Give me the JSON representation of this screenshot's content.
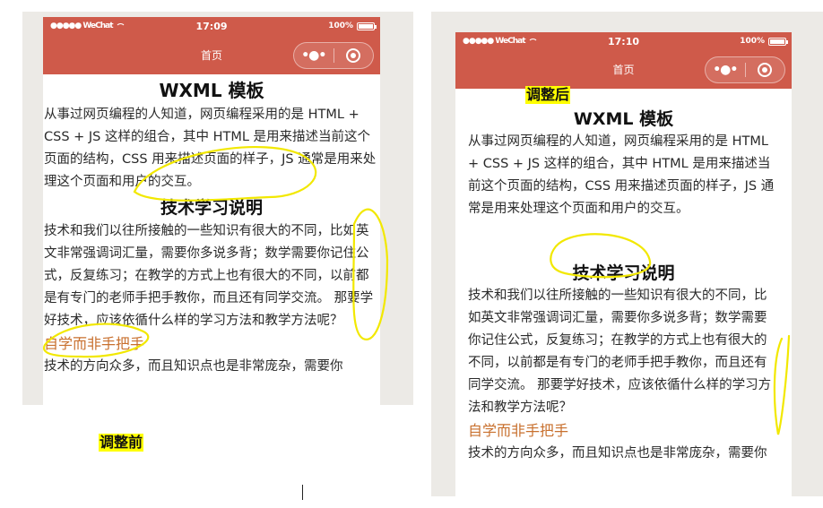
{
  "labels": {
    "before": "调整前",
    "after": "调整后"
  },
  "status_bar": {
    "carrier": "●●●●● WeChat",
    "battery": "100%",
    "time_before": "17:09",
    "time_after": "17:10"
  },
  "nav": {
    "title": "首页",
    "menu_glyph": "•●•"
  },
  "article": {
    "heading1": "WXML 模板",
    "para1": "从事过网页编程的人知道，网页编程采用的是 HTML + CSS + JS 这样的组合，其中 HTML 是用来描述当前这个页面的结构，CSS 用来描述页面的样子，JS 通常是用来处理这个页面和用户的交互。",
    "heading2": "技术学习说明",
    "para2": "技术和我们以往所接触的一些知识有很大的不同，比如英文非常强调词汇量，需要你多说多背；数学需要你记住公式，反复练习；在教学的方式上也有很大的不同，以前都是有专门的老师手把手教你，而且还有同学交流。 那要学好技术，应该依循什么样的学习方法和教学方法呢？",
    "subheading": "自学而非手把手",
    "para3": "技术的方向众多，而且知识点也是非常庞杂，需要你"
  },
  "colors": {
    "navbar": "#cf5a4a",
    "annotation": "#f2e800",
    "subheading": "#c8702e"
  }
}
